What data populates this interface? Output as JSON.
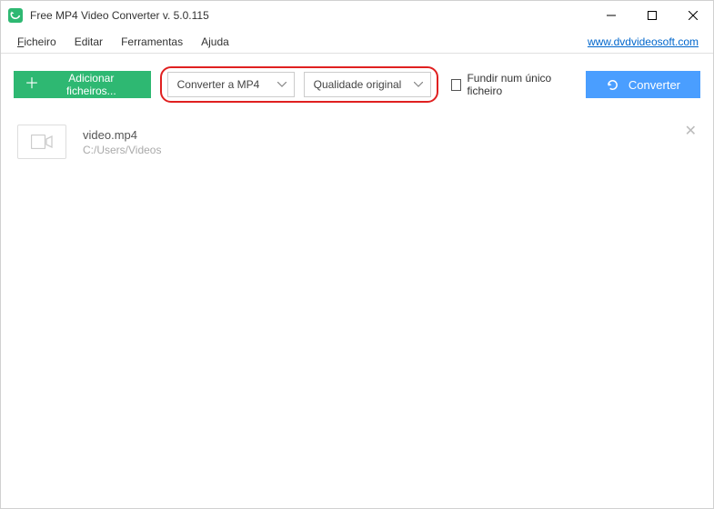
{
  "titlebar": {
    "title": "Free MP4 Video Converter v. 5.0.115"
  },
  "menubar": {
    "file": "Ficheiro",
    "edit": "Editar",
    "tools": "Ferramentas",
    "help": "Ajuda",
    "link": "www.dvdvideosoft.com"
  },
  "toolbar": {
    "add_files": "Adicionar ficheiros...",
    "format_select": "Converter a MP4",
    "quality_select": "Qualidade original",
    "merge_label": "Fundir num único ficheiro",
    "convert": "Converter"
  },
  "files": [
    {
      "name": "video.mp4",
      "path": "C:/Users/Videos"
    }
  ]
}
